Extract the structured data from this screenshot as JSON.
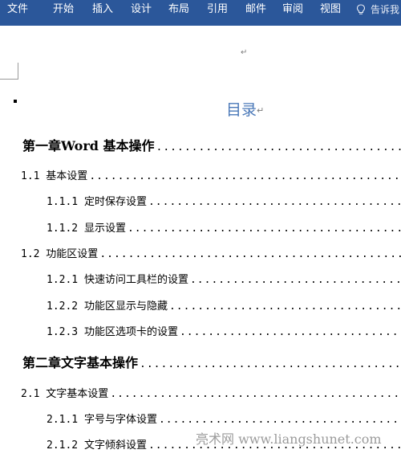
{
  "ribbon": {
    "tabs": [
      "文件",
      "开始",
      "插入",
      "设计",
      "布局",
      "引用",
      "邮件",
      "审阅",
      "视图"
    ],
    "tell_me": "告诉我"
  },
  "document": {
    "toc_title": "目录",
    "paragraph_mark": "↵",
    "entries": [
      {
        "level": 1,
        "text": "第一章Word 基本操作"
      },
      {
        "level": 2,
        "text": "1.1 基本设置"
      },
      {
        "level": 3,
        "text": "1.1.1 定时保存设置"
      },
      {
        "level": 3,
        "text": "1.1.2 显示设置"
      },
      {
        "level": 2,
        "text": "1.2 功能区设置"
      },
      {
        "level": 3,
        "text": "1.2.1 快速访问工具栏的设置"
      },
      {
        "level": 3,
        "text": "1.2.2 功能区显示与隐藏"
      },
      {
        "level": 3,
        "text": "1.2.3 功能区选项卡的设置"
      },
      {
        "level": 1,
        "text": "第二章文字基本操作"
      },
      {
        "level": 2,
        "text": "2.1 文字基本设置"
      },
      {
        "level": 3,
        "text": "2.1.1 字号与字体设置"
      },
      {
        "level": 3,
        "text": "2.1.2 文字倾斜设置"
      }
    ]
  },
  "watermark": "亮术网 www.liangshunet.com"
}
